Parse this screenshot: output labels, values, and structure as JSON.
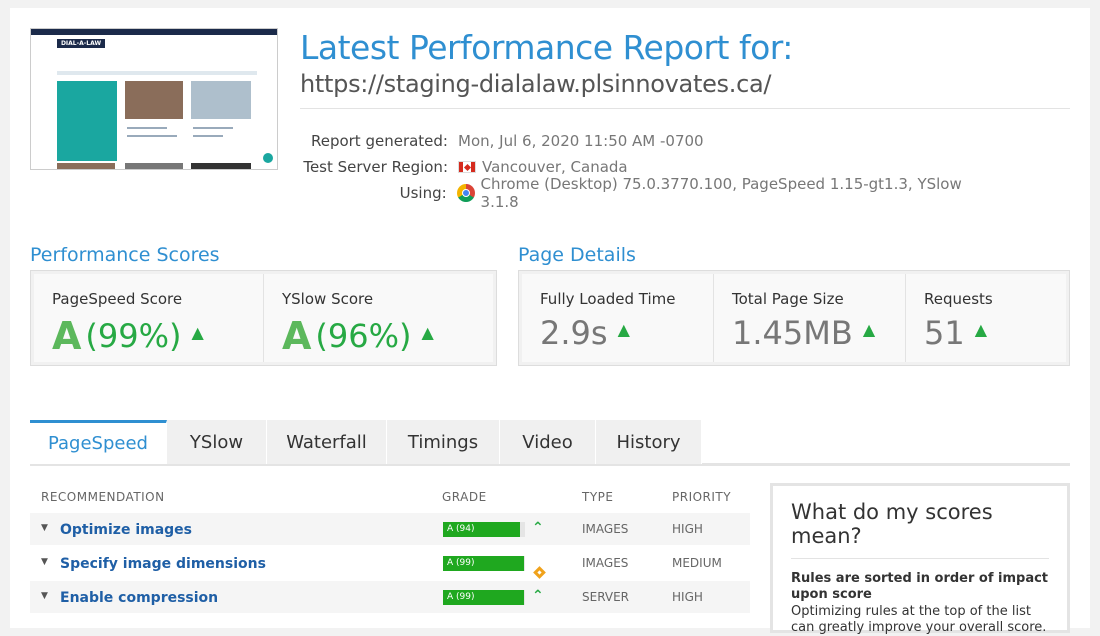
{
  "header": {
    "title": "Latest Performance Report for:",
    "url": "https://staging-dialalaw.plsinnovates.ca/",
    "thumbnail_logo": "DIAL-A-LAW"
  },
  "meta": {
    "generated_label": "Report generated:",
    "generated_value": "Mon, Jul 6, 2020 11:50 AM -0700",
    "region_label": "Test Server Region:",
    "region_value": "Vancouver, Canada",
    "using_label": "Using:",
    "using_value": "Chrome (Desktop) 75.0.3770.100, PageSpeed 1.15-gt1.3, YSlow 3.1.8"
  },
  "performance": {
    "title": "Performance Scores",
    "pagespeed_label": "PageSpeed Score",
    "pagespeed_grade": "A",
    "pagespeed_pct": "(99%)",
    "yslow_label": "YSlow Score",
    "yslow_grade": "A",
    "yslow_pct": "(96%)"
  },
  "details": {
    "title": "Page Details",
    "loaded_label": "Fully Loaded Time",
    "loaded_value": "2.9s",
    "size_label": "Total Page Size",
    "size_value": "1.45MB",
    "requests_label": "Requests",
    "requests_value": "51"
  },
  "tabs": [
    "PageSpeed",
    "YSlow",
    "Waterfall",
    "Timings",
    "Video",
    "History"
  ],
  "table": {
    "headers": {
      "recommendation": "RECOMMENDATION",
      "grade": "GRADE",
      "type": "TYPE",
      "priority": "PRIORITY"
    },
    "rows": [
      {
        "rec": "Optimize images",
        "grade": "A (94)",
        "score": 94,
        "type": "IMAGES",
        "priority": "HIGH",
        "trend": "up"
      },
      {
        "rec": "Specify image dimensions",
        "grade": "A (99)",
        "score": 99,
        "type": "IMAGES",
        "priority": "MEDIUM",
        "trend": "neutral"
      },
      {
        "rec": "Enable compression",
        "grade": "A (99)",
        "score": 99,
        "type": "SERVER",
        "priority": "HIGH",
        "trend": "up"
      }
    ]
  },
  "side": {
    "title": "What do my scores mean?",
    "bold": "Rules are sorted in order of impact upon score",
    "text": "Optimizing rules at the top of the list can greatly improve your overall score."
  },
  "colors": {
    "accent": "#2f8fd1",
    "good": "#27a944",
    "grade_bar": "#1fa81f",
    "warn": "#f0a21b"
  }
}
